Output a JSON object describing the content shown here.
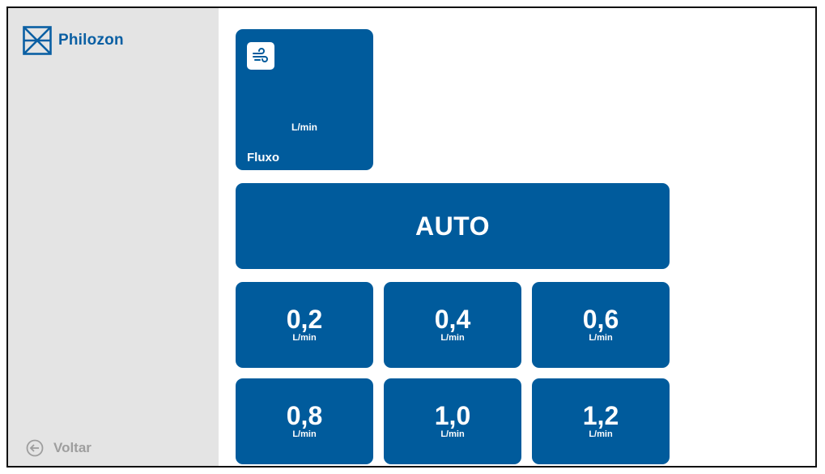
{
  "brand": {
    "name": "Philozon",
    "logo_icon": "philozon-logo-icon",
    "color": "#0a5fa3"
  },
  "sidebar": {
    "back_label": "Voltar",
    "back_icon": "arrow-left-circle-icon"
  },
  "flow_card": {
    "icon": "wind-icon",
    "value": "",
    "unit": "L/min",
    "label": "Fluxo"
  },
  "auto_button": {
    "label": "AUTO"
  },
  "flow_options": [
    {
      "value": "0,2",
      "unit": "L/min"
    },
    {
      "value": "0,4",
      "unit": "L/min"
    },
    {
      "value": "0,6",
      "unit": "L/min"
    },
    {
      "value": "0,8",
      "unit": "L/min"
    },
    {
      "value": "1,0",
      "unit": "L/min"
    },
    {
      "value": "1,2",
      "unit": "L/min"
    }
  ],
  "colors": {
    "tile": "#005b9c",
    "sidebar": "#e4e4e4",
    "back_text": "#9e9e9e"
  }
}
